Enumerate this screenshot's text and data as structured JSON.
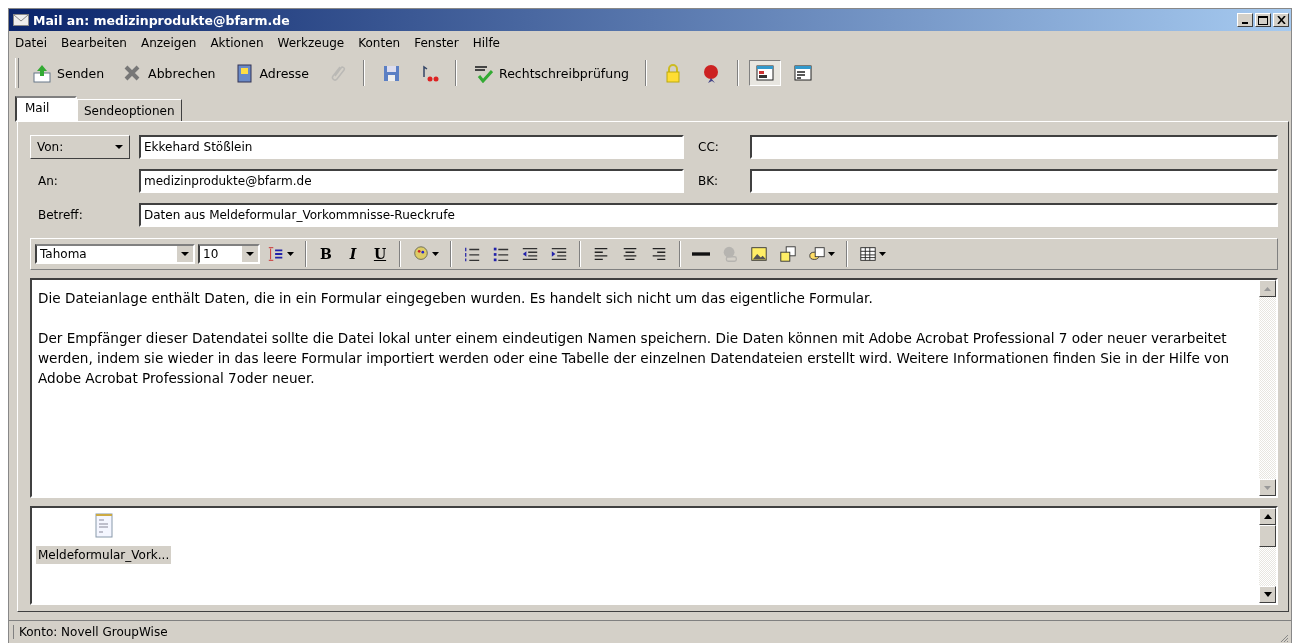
{
  "window": {
    "title": "Mail an: medizinprodukte@bfarm.de"
  },
  "menu": [
    "Datei",
    "Bearbeiten",
    "Anzeigen",
    "Aktionen",
    "Werkzeuge",
    "Konten",
    "Fenster",
    "Hilfe"
  ],
  "toolbar": [
    {
      "kind": "button",
      "label": "Senden",
      "disabled": false,
      "selected": false
    },
    {
      "kind": "button",
      "label": "Abbrechen",
      "disabled": false,
      "selected": false
    },
    {
      "kind": "button",
      "label": "Adresse",
      "disabled": false,
      "selected": false
    },
    {
      "kind": "icon",
      "disabled": true,
      "selected": false
    },
    {
      "kind": "sep"
    },
    {
      "kind": "icon",
      "disabled": false,
      "selected": false
    },
    {
      "kind": "icon",
      "disabled": false,
      "selected": false
    },
    {
      "kind": "sep"
    },
    {
      "kind": "button",
      "label": "Rechtschreibprüfung",
      "disabled": false,
      "selected": false
    },
    {
      "kind": "sep"
    },
    {
      "kind": "icon",
      "disabled": false,
      "selected": false
    },
    {
      "kind": "icon",
      "disabled": false,
      "selected": false
    },
    {
      "kind": "sep"
    },
    {
      "kind": "icon",
      "disabled": false,
      "selected": true
    },
    {
      "kind": "icon",
      "disabled": false,
      "selected": false
    }
  ],
  "tabs": [
    {
      "label": "Mail",
      "selected": true
    },
    {
      "label": "Sendeoptionen",
      "selected": false
    }
  ],
  "fields": {
    "from": {
      "label": "Von:",
      "value": "Ekkehard Stößlein"
    },
    "to": {
      "label": "An:",
      "value": "medizinprodukte@bfarm.de"
    },
    "subject": {
      "label": "Betreff:",
      "value": "Daten aus Meldeformular_Vorkommnisse-Rueckrufe"
    },
    "cc": {
      "label": "CC:"
    },
    "bk": {
      "label": "BK:"
    }
  },
  "format_toolbar": [
    {
      "kind": "select",
      "value": "Tahoma"
    },
    {
      "kind": "select",
      "value": "10"
    },
    {
      "kind": "icon",
      "disabled": false
    },
    {
      "kind": "sep"
    },
    {
      "kind": "text",
      "label": "B",
      "disabled": false
    },
    {
      "kind": "text",
      "label": "I",
      "disabled": false
    },
    {
      "kind": "text",
      "label": "U",
      "disabled": false
    },
    {
      "kind": "sep"
    },
    {
      "kind": "icon",
      "disabled": false
    },
    {
      "kind": "sep"
    },
    {
      "kind": "icon",
      "disabled": false
    },
    {
      "kind": "icon",
      "disabled": false
    },
    {
      "kind": "icon",
      "disabled": false
    },
    {
      "kind": "icon",
      "disabled": false
    },
    {
      "kind": "sep"
    },
    {
      "kind": "icon",
      "disabled": false
    },
    {
      "kind": "icon",
      "disabled": false
    },
    {
      "kind": "icon",
      "disabled": false
    },
    {
      "kind": "sep"
    },
    {
      "kind": "icon",
      "disabled": false
    },
    {
      "kind": "icon",
      "disabled": true
    },
    {
      "kind": "icon",
      "disabled": false
    },
    {
      "kind": "icon",
      "disabled": false
    },
    {
      "kind": "icon",
      "disabled": false
    },
    {
      "kind": "sep"
    },
    {
      "kind": "icon",
      "disabled": false
    }
  ],
  "body": [
    "Die Dateianlage enthält Daten, die in ein Formular eingegeben wurden. Es handelt sich nicht um das eigentliche Formular.",
    "Der Empfänger dieser Datendatei sollte die Datei lokal unter einem eindeutigen Namen speichern. Die Daten können mit Adobe Acrobat Professional 7 oder neuer verarbeitet werden, indem sie wieder in das leere Formular importiert werden oder eine Tabelle der einzelnen Datendateien erstellt wird. Weitere Informationen finden Sie in der Hilfe von Adobe Acrobat Professional 7oder neuer."
  ],
  "attachments": [
    {
      "name": "Meldeformular_Vork...",
      "selected": true
    }
  ],
  "status_bar": "Konto: Novell GroupWise"
}
